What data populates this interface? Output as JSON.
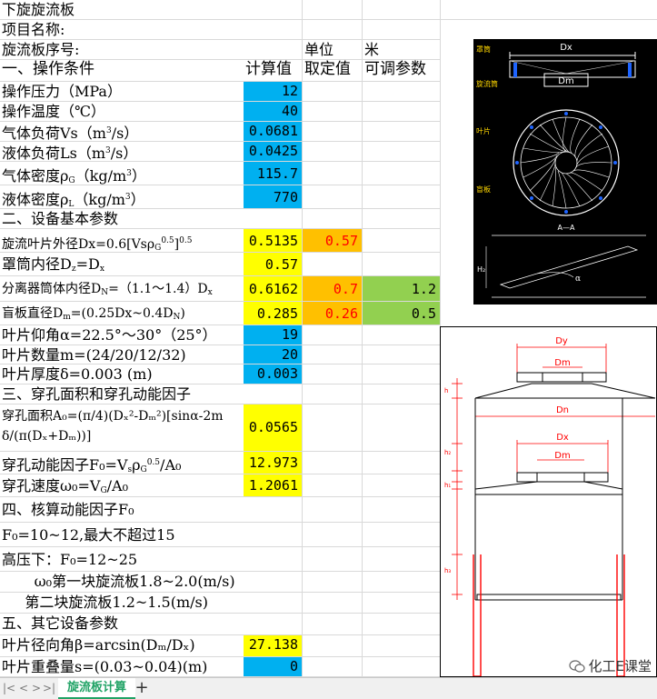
{
  "sheet": {
    "rows": [
      {
        "a": "下旋旋流板"
      },
      {
        "a": "项目名称:"
      },
      {
        "a": "旋流板序号:",
        "c": "单位",
        "d": "米"
      },
      {
        "a": "一、操作条件",
        "b": "计算值",
        "c": "取定值",
        "d": "可调参数"
      },
      {
        "a": "操作压力（MPa）",
        "b": "12"
      },
      {
        "a": "操作温度（℃）",
        "b": "40"
      },
      {
        "a_pre": "气体负荷Vs（m",
        "a_sup": "3",
        "a_post": "/s）",
        "b": "0.0681"
      },
      {
        "a_pre": "液体负荷Ls（m",
        "a_sup": "3",
        "a_post": "/s）",
        "b": "0.0425"
      },
      {
        "a_pre": "气体密度ρ",
        "a_sub": "G",
        "a_mid": "（kg/m",
        "a_sup": "3",
        "a_post": "）",
        "b": "115.7"
      },
      {
        "a_pre": "液体密度ρ",
        "a_sub": "L",
        "a_mid": "（kg/m",
        "a_sup": "3",
        "a_post": "）",
        "b": "770"
      },
      {
        "a": "二、设备基本参数"
      },
      {
        "a": "旋流叶片外径Dx=0.6[Vsρ",
        "a_sub": "G",
        "a_sup": "0.5",
        "a_post": "]",
        "a_sup2": "0.5",
        "b": "0.5135",
        "c": "0.57"
      },
      {
        "a": "罩筒内径D",
        "a_sub": "z",
        "a_post": "=D",
        "a_sub2": "x",
        "b": "0.57"
      },
      {
        "a": "分离器筒体内径D",
        "a_sub": "N",
        "a_post": "=（1.1～1.4）D",
        "a_sub2": "x",
        "b": "0.6162",
        "c": "0.7",
        "d": "1.2"
      },
      {
        "a": "盲板直径D",
        "a_sub": "m",
        "a_post": "=(0.25Dx~0.4D",
        "a_sub2": "N",
        "a_post2": ")",
        "b": "0.285",
        "c": "0.26",
        "d": "0.5"
      },
      {
        "a": " 叶片仰角α=22.5°～30°（25°）",
        "b": "19"
      },
      {
        "a": "叶片数量m=(24/20/12/32)",
        "b": "20"
      },
      {
        "a": "叶片厚度δ=0.003 (m)",
        "b": "0.003"
      },
      {
        "a": "三、穿孔面积和穿孔动能因子"
      },
      {
        "a_line1": "穿孔面积A₀=(π/4)(Dₓ²-Dₘ²)[sinα-2m",
        "a_line2": "δ/(π(Dₓ+Dₘ))]",
        "b": "0.0565"
      },
      {
        "a": "穿孔动能因子F₀=V",
        "a_sub": "s",
        "a_post": "ρ",
        "a_sub2": "G",
        "a_sup": "0.5",
        "a_post2": "/A₀",
        "b": "12.973"
      },
      {
        "a": "穿孔速度ω₀=V",
        "a_sub": "G",
        "a_post": "/A₀",
        "b": "1.2061"
      },
      {
        "a": "四、核算动能因子F₀"
      },
      {
        "a": "F₀=10~12,最大不超过15"
      },
      {
        "a": "高压下：F₀=12~25"
      },
      {
        "a": "       ω₀第一块旋流板1.8~2.0(m/s)"
      },
      {
        "a": "     第二块旋流板1.2~1.5(m/s)"
      },
      {
        "a": "五、其它设备参数"
      },
      {
        "a": "叶片径向角β=arcsin(Dₘ/Dₓ)",
        "b": "27.138"
      },
      {
        "a": "叶片重叠量s=(0.03~0.04)(m)",
        "b": "0"
      }
    ]
  },
  "drawing1": {
    "labels": {
      "dx": "Dx",
      "dm": "Dm",
      "zhao": "罩筒",
      "xuanliu": "旋流筒",
      "yepian": "叶片",
      "mangban": "盲板",
      "section": "A—A",
      "h": "H₂",
      "alpha": "α"
    }
  },
  "drawing2": {
    "labels": {
      "dy": "Dy",
      "dm1": "Dm",
      "dn": "Dn",
      "dx": "Dx",
      "dm2": "Dm",
      "h": "h",
      "h1": "h₁",
      "h2": "h₂",
      "h3": "h₃"
    }
  },
  "tabs": {
    "active": "旋流板计算",
    "add": "+",
    "first": "|<",
    "prev": "<",
    "next": ">",
    "last": ">|"
  },
  "watermark": {
    "text": "化工E课堂"
  }
}
